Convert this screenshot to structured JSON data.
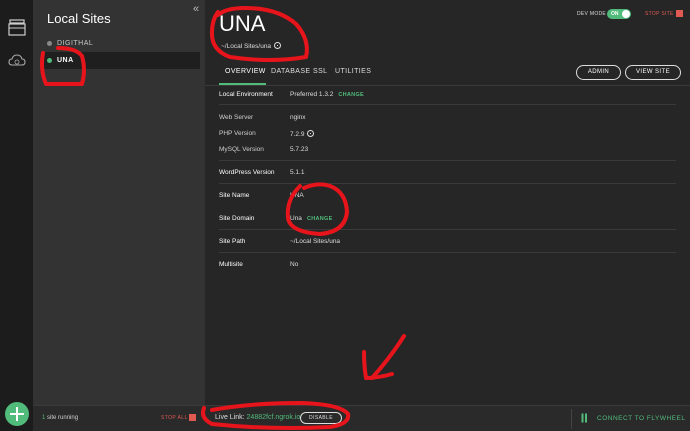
{
  "sidebar": {
    "title": "Local Sites",
    "collapse_icon": "«",
    "sites": [
      {
        "name": "DIGITHAL",
        "status": "stopped"
      },
      {
        "name": "UNA",
        "status": "running"
      }
    ]
  },
  "bottom": {
    "running_count": "1",
    "running_text": "site running",
    "stop_all": "STOP ALL",
    "live_link_label": "Live Link:",
    "live_link_url": "24882fcf.ngrok.io",
    "disable": "DISABLE",
    "connect_flywheel": "CONNECT TO FLYWHEEL"
  },
  "header": {
    "site_title": "UNA",
    "site_path": "~/Local Sites/una",
    "dev_mode_label": "DEV MODE",
    "toggle_label": "ON",
    "stop_site": "STOP SITE"
  },
  "tabs": [
    "OVERVIEW",
    "DATABASE",
    "SSL",
    "UTILITIES"
  ],
  "buttons": {
    "admin": "ADMIN",
    "view_site": "VIEW SITE"
  },
  "overview": {
    "local_environment": {
      "label": "Local Environment",
      "value": "Preferred 1.3.2",
      "change": "CHANGE"
    },
    "web_server": {
      "label": "Web Server",
      "value": "nginx"
    },
    "php_version": {
      "label": "PHP Version",
      "value": "7.2.9"
    },
    "mysql_version": {
      "label": "MySQL Version",
      "value": "5.7.23"
    },
    "wordpress_version": {
      "label": "WordPress Version",
      "value": "5.1.1"
    },
    "site_name": {
      "label": "Site Name",
      "value": "UNA"
    },
    "site_domain": {
      "label": "Site Domain",
      "value": "Una",
      "change": "CHANGE"
    },
    "site_path": {
      "label": "Site Path",
      "value": "~/Local Sites/una"
    },
    "multisite": {
      "label": "Multisite",
      "value": "No"
    }
  },
  "colors": {
    "accent": "#51bb7b",
    "danger": "#e05a52",
    "annotation": "#e8141b"
  },
  "icons": [
    "sites-icon",
    "cloud-icon",
    "add-site-icon",
    "info-icon",
    "flywheel-icon",
    "stop-icon"
  ]
}
